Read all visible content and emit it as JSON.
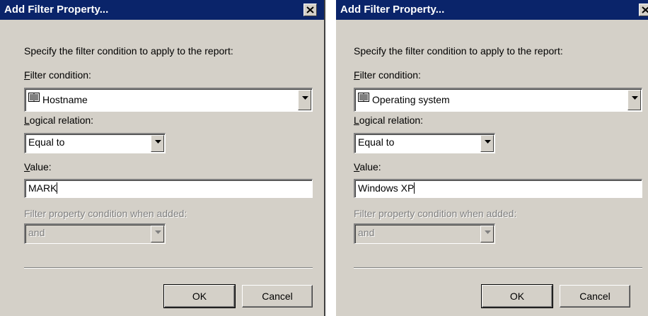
{
  "dialogs": [
    {
      "title": "Add Filter Property...",
      "prompt": "Specify the filter condition to apply to the report:",
      "filter_condition_label": "Filter condition:",
      "filter_condition_value": "Hostname",
      "logical_relation_label": "Logical relation:",
      "logical_relation_value": "Equal to",
      "value_label": "Value:",
      "value_input": "MARK",
      "when_added_label": "Filter property condition when added:",
      "when_added_value": "and",
      "ok_label": "OK",
      "cancel_label": "Cancel"
    },
    {
      "title": "Add Filter Property...",
      "prompt": "Specify the filter condition to apply to the report:",
      "filter_condition_label": "Filter condition:",
      "filter_condition_value": "Operating system",
      "logical_relation_label": "Logical relation:",
      "logical_relation_value": "Equal to",
      "value_label": "Value:",
      "value_input": "Windows XP",
      "when_added_label": "Filter property condition when added:",
      "when_added_value": "and",
      "ok_label": "OK",
      "cancel_label": "Cancel"
    }
  ],
  "colors": {
    "titlebar": "#0a246a",
    "face": "#d4d0c8",
    "disabled_text": "#808080"
  },
  "icons": {
    "close": "close-icon",
    "dropdown": "chevron-down-icon",
    "filter_item": "book-icon"
  }
}
